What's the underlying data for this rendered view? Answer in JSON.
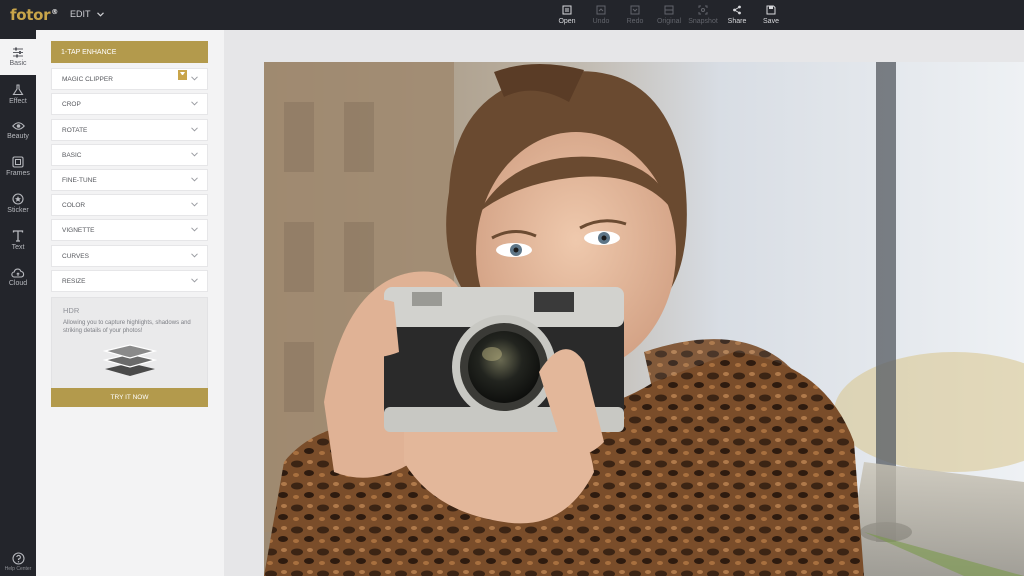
{
  "app": {
    "logo": "fotor",
    "logo_mark": "®"
  },
  "menu": {
    "edit_label": "EDIT"
  },
  "toolbar": [
    {
      "label": "Open",
      "icon": "open-icon",
      "enabled": true
    },
    {
      "label": "Undo",
      "icon": "undo-icon",
      "enabled": false
    },
    {
      "label": "Redo",
      "icon": "redo-icon",
      "enabled": false
    },
    {
      "label": "Original",
      "icon": "original-icon",
      "enabled": false
    },
    {
      "label": "Snapshot",
      "icon": "snapshot-icon",
      "enabled": false
    },
    {
      "label": "Share",
      "icon": "share-icon",
      "enabled": true
    },
    {
      "label": "Save",
      "icon": "save-icon",
      "enabled": true
    }
  ],
  "rail": [
    {
      "label": "Basic",
      "icon": "sliders-icon",
      "active": true
    },
    {
      "label": "Effect",
      "icon": "flask-icon",
      "active": false
    },
    {
      "label": "Beauty",
      "icon": "eye-icon",
      "active": false
    },
    {
      "label": "Frames",
      "icon": "frame-icon",
      "active": false
    },
    {
      "label": "Sticker",
      "icon": "sticker-icon",
      "active": false
    },
    {
      "label": "Text",
      "icon": "text-icon",
      "active": false
    },
    {
      "label": "Cloud",
      "icon": "cloud-icon",
      "active": false
    }
  ],
  "help": {
    "label": "Help Center"
  },
  "panel": {
    "enhance_label": "1-TAP ENHANCE",
    "sections": [
      {
        "label": "MAGIC CLIPPER",
        "badge": true
      },
      {
        "label": "CROP"
      },
      {
        "label": "ROTATE"
      },
      {
        "label": "BASIC"
      },
      {
        "label": "FINE-TUNE"
      },
      {
        "label": "COLOR"
      },
      {
        "label": "VIGNETTE"
      },
      {
        "label": "CURVES"
      },
      {
        "label": "RESIZE"
      }
    ],
    "hdr": {
      "title": "HDR",
      "description": "Allowing you to capture highlights, shadows and striking details of your photos!",
      "cta": "TRY IT NOW"
    }
  },
  "colors": {
    "accent": "#b39a4c",
    "topbar": "#23252b",
    "panel": "#f3f3f4",
    "canvas": "#e6e6e8"
  }
}
